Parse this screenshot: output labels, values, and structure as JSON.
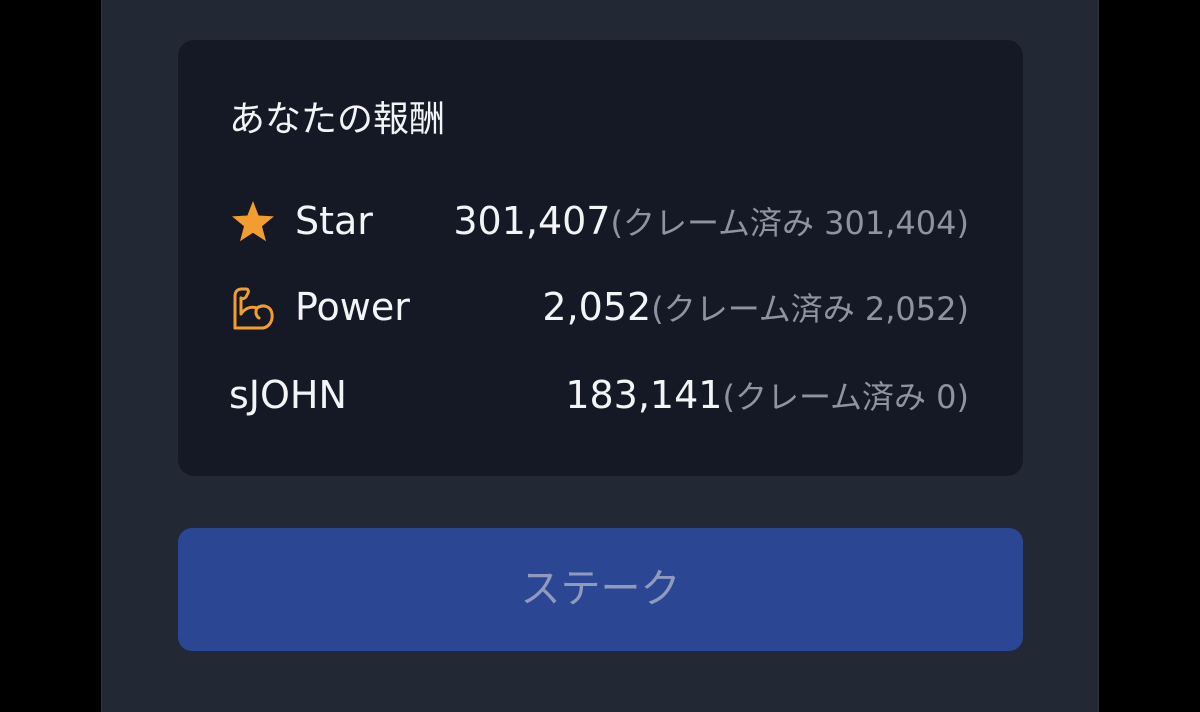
{
  "rewards": {
    "title": "あなたの報酬",
    "items": [
      {
        "icon": "star-icon",
        "label": "Star",
        "amount": "301,407",
        "claimed_text": "(クレーム済み 301,404)",
        "icon_color": "#f39c2f"
      },
      {
        "icon": "flexed-arm-icon",
        "label": "Power",
        "amount": "2,052",
        "claimed_text": "(クレーム済み 2,052)",
        "icon_color": "#f39c2f"
      },
      {
        "icon": null,
        "label": "sJOHN",
        "amount": "183,141",
        "claimed_text": "(クレーム済み 0)"
      }
    ]
  },
  "actions": {
    "stake_label": "ステーク"
  },
  "colors": {
    "panel_bg": "#222834",
    "card_bg": "#141925",
    "button_bg": "#2b4693",
    "accent_orange": "#f39c2f"
  }
}
